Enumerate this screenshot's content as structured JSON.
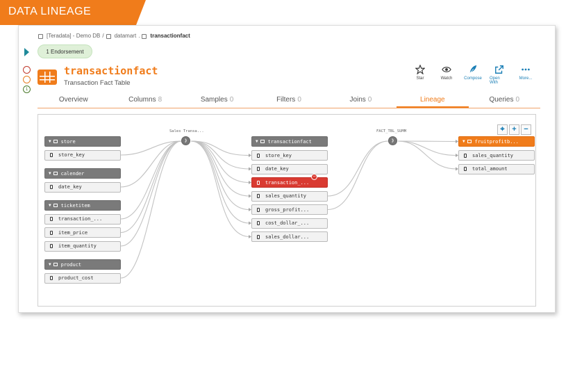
{
  "banner": {
    "label": "DATA LINEAGE",
    "color": "#f07c1b"
  },
  "breadcrumb": {
    "source": "[Teradata] - Demo DB",
    "sep1": "/",
    "schema": "datamart",
    "sep2": ".",
    "table": "transactionfact"
  },
  "endorsement": "1 Endorsement",
  "status": {
    "green_count": "1"
  },
  "header": {
    "title": "transactionfact",
    "subtitle": "Transaction Fact Table"
  },
  "actions": [
    {
      "label": "Star",
      "icon": "star-icon"
    },
    {
      "label": "Watch",
      "icon": "eye-icon"
    },
    {
      "label": "Compose",
      "icon": "feather-icon"
    },
    {
      "label": "Open With",
      "icon": "external-link-icon"
    },
    {
      "label": "More...",
      "icon": "more-icon"
    }
  ],
  "tabs": [
    {
      "label": "Overview",
      "count": ""
    },
    {
      "label": "Columns",
      "count": "8"
    },
    {
      "label": "Samples",
      "count": "0"
    },
    {
      "label": "Filters",
      "count": "0"
    },
    {
      "label": "Joins",
      "count": "0"
    },
    {
      "label": "Lineage",
      "count": ""
    },
    {
      "label": "Queries",
      "count": "0"
    }
  ],
  "active_tab": "Lineage",
  "zoom": {
    "fit": "⌖",
    "in": "+",
    "out": "−"
  },
  "lineage": {
    "sources": [
      {
        "table": "store",
        "columns": [
          "store_key"
        ]
      },
      {
        "table": "calender",
        "columns": [
          "date_key"
        ]
      },
      {
        "table": "ticketitem",
        "columns": [
          "transaction_...",
          "item_price",
          "item_quantity"
        ]
      },
      {
        "table": "product",
        "columns": [
          "product_cost"
        ]
      }
    ],
    "process1": "Sales Transa...",
    "center": {
      "table": "transactionfact",
      "columns": [
        "store_key",
        "date_key",
        "transaction_...",
        "sales_quantity",
        "gross_profit...",
        "cost_dollar_...",
        "sales_dollar..."
      ],
      "highlighted": "transaction_..."
    },
    "process2": "FACT_TBL_SUMM",
    "target": {
      "table": "fruitprofitb...",
      "columns": [
        "sales_quantity",
        "total_amount"
      ]
    }
  },
  "colors": {
    "accent": "#f07c1b",
    "highlight": "#d93a31",
    "link": "#1b7fb6"
  }
}
